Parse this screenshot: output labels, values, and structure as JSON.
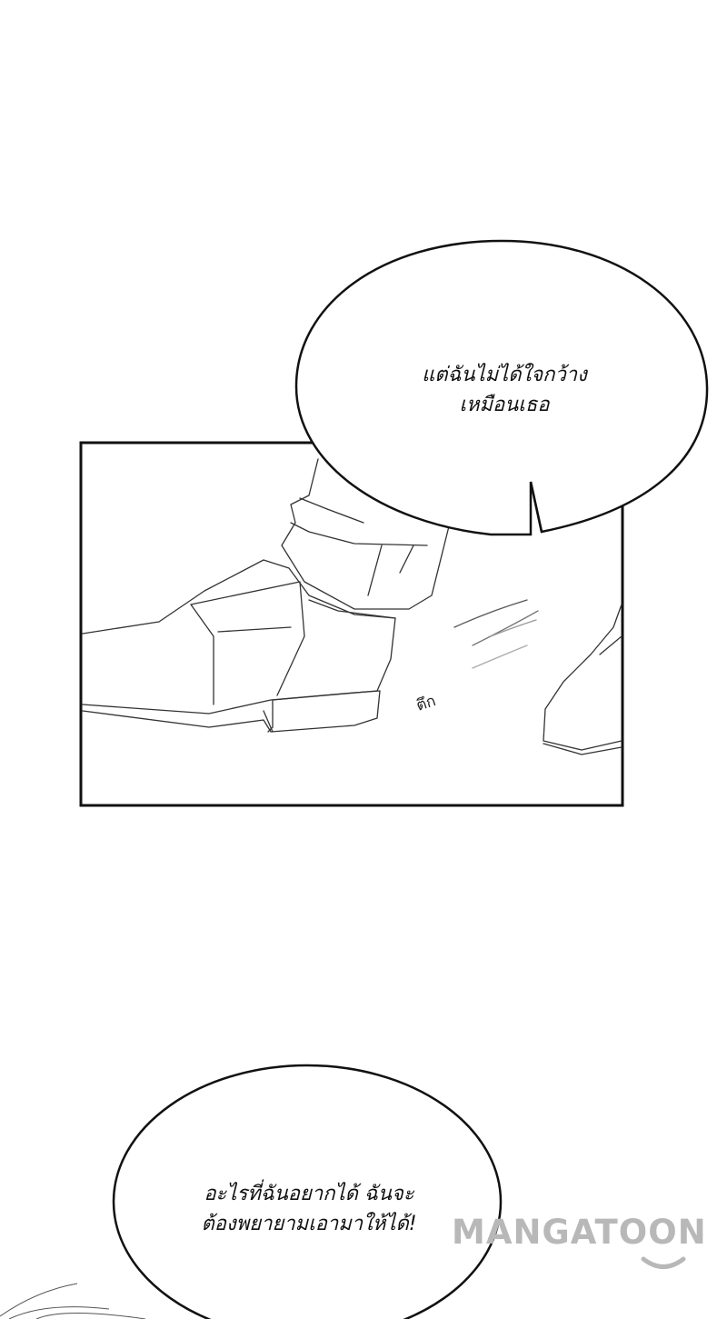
{
  "bubbles": {
    "top": {
      "line1": "แต่ฉันไม่ได้ใจกว้าง",
      "line2": "เหมือนเธอ"
    },
    "bottom": {
      "line1": "อะไรที่ฉันอยากได้ ฉันจะ",
      "line2": "ต้องพยายามเอามาให้ได้!"
    }
  },
  "sound_effect": "ตึก",
  "watermark": {
    "text": "MANGATOON",
    "color": "#b8b8b8"
  },
  "colors": {
    "background": "#ffffff",
    "ink": "#111111"
  }
}
